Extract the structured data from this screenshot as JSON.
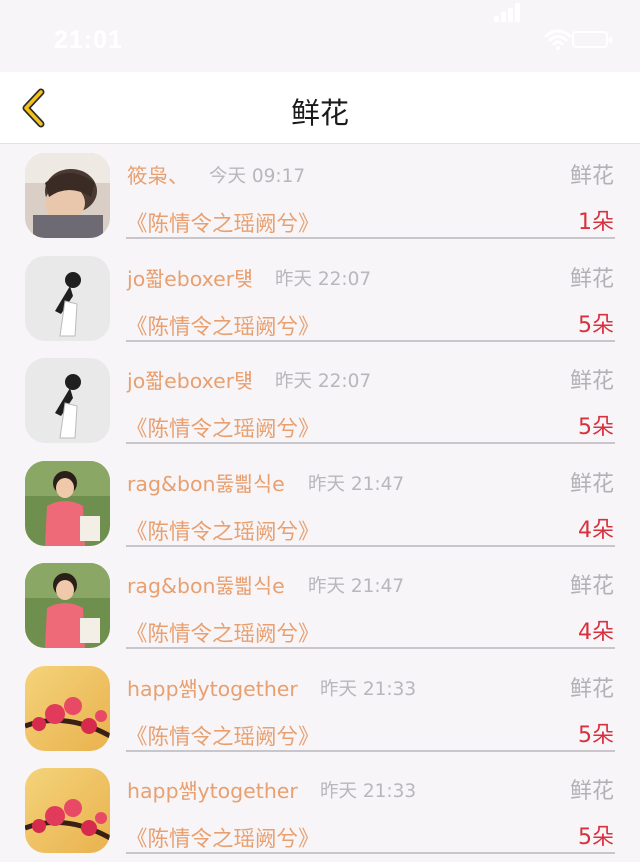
{
  "status_bar": {
    "time": "21:01"
  },
  "nav": {
    "title": "鲜花"
  },
  "icons": {
    "back": "chevron-left-icon",
    "signal": "signal-icon",
    "wifi": "wifi-icon",
    "battery": "battery-icon"
  },
  "colors": {
    "accent_orange": "#e8a070",
    "count_red": "#d8313e",
    "back_arrow": "#f3c21a",
    "muted_gray": "#b4b1b6"
  },
  "rows": [
    {
      "name": "筱枭、",
      "time": "今天 09:17",
      "gift": "鲜花",
      "drama": "《陈情令之瑶阙兮》",
      "count": "1朵",
      "avatar": "boy-portrait"
    },
    {
      "name": "jo쫣eboxer턪",
      "time": "昨天 22:07",
      "gift": "鲜花",
      "drama": "《陈情令之瑶阙兮》",
      "count": "5朵",
      "avatar": "sketch-figure"
    },
    {
      "name": "jo쫣eboxer턪",
      "time": "昨天 22:07",
      "gift": "鲜花",
      "drama": "《陈情令之瑶阙兮》",
      "count": "5朵",
      "avatar": "sketch-figure"
    },
    {
      "name": "rag&bon뚫쁿식e",
      "time": "昨天 21:47",
      "gift": "鲜花",
      "drama": "《陈情令之瑶阙兮》",
      "count": "4朵",
      "avatar": "girl-pink-shirt"
    },
    {
      "name": "rag&bon뚫쁿식e",
      "time": "昨天 21:47",
      "gift": "鲜花",
      "drama": "《陈情令之瑶阙兮》",
      "count": "4朵",
      "avatar": "girl-pink-shirt"
    },
    {
      "name": "happ쌝ytogether",
      "time": "昨天 21:33",
      "gift": "鲜花",
      "drama": "《陈情令之瑶阙兮》",
      "count": "5朵",
      "avatar": "plum-blossom"
    },
    {
      "name": "happ쌝ytogether",
      "time": "昨天 21:33",
      "gift": "鲜花",
      "drama": "《陈情令之瑶阙兮》",
      "count": "5朵",
      "avatar": "plum-blossom"
    }
  ]
}
